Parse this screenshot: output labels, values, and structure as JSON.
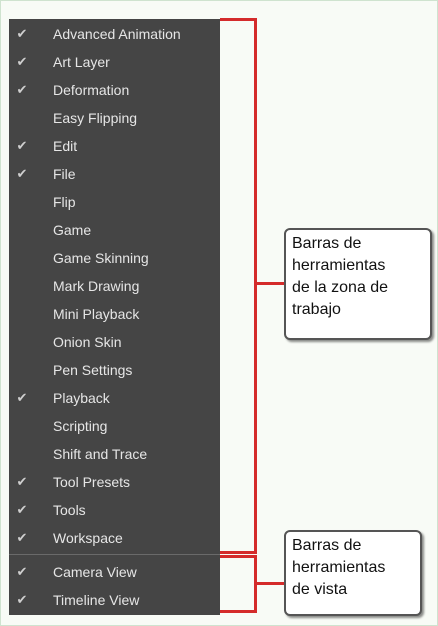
{
  "menu": {
    "items": [
      {
        "label": "Advanced Animation",
        "checked": true
      },
      {
        "label": "Art Layer",
        "checked": true
      },
      {
        "label": "Deformation",
        "checked": true
      },
      {
        "label": "Easy Flipping",
        "checked": false
      },
      {
        "label": "Edit",
        "checked": true
      },
      {
        "label": "File",
        "checked": true
      },
      {
        "label": "Flip",
        "checked": false
      },
      {
        "label": "Game",
        "checked": false
      },
      {
        "label": "Game Skinning",
        "checked": false
      },
      {
        "label": "Mark Drawing",
        "checked": false
      },
      {
        "label": "Mini Playback",
        "checked": false
      },
      {
        "label": "Onion Skin",
        "checked": false
      },
      {
        "label": "Pen Settings",
        "checked": false
      },
      {
        "label": "Playback",
        "checked": true
      },
      {
        "label": "Scripting",
        "checked": false
      },
      {
        "label": "Shift and Trace",
        "checked": false
      },
      {
        "label": "Tool Presets",
        "checked": true
      },
      {
        "label": "Tools",
        "checked": true
      },
      {
        "label": "Workspace",
        "checked": true
      },
      {
        "label": "Camera View",
        "checked": true
      },
      {
        "label": "Timeline View",
        "checked": true
      }
    ],
    "check_glyph": "✔"
  },
  "callouts": {
    "workspace": {
      "lines": [
        "Barras de",
        "herramientas",
        "de la zona de",
        "trabajo"
      ]
    },
    "view": {
      "lines": [
        "Barras de",
        "herramientas",
        "de vista"
      ]
    }
  },
  "colors": {
    "menu_bg": "#454545",
    "bracket": "#d42b2b",
    "text": "#e6e6e6"
  }
}
